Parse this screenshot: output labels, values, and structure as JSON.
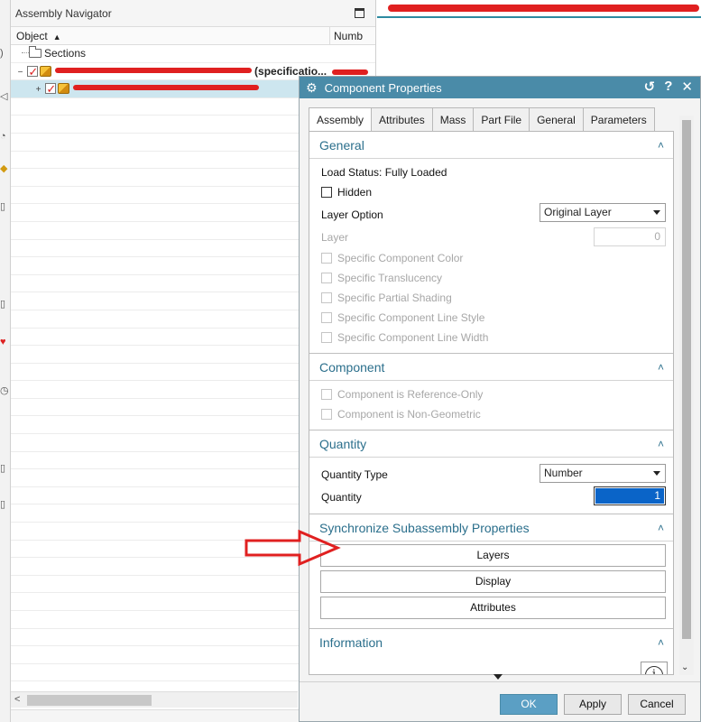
{
  "navigator": {
    "title": "Assembly Navigator",
    "columns": {
      "object": "Object",
      "number": "Numb"
    },
    "rows": [
      {
        "label": "Sections"
      },
      {
        "label": "(specificatio..."
      },
      {
        "label": ""
      }
    ],
    "empty_row_count": 33
  },
  "dialog": {
    "title": "Component Properties",
    "title_buttons": {
      "reset": "↺",
      "help": "?",
      "close": "✕"
    },
    "tabs": [
      "Assembly",
      "Attributes",
      "Mass",
      "Part File",
      "General",
      "Parameters"
    ],
    "active_tab": "Assembly",
    "general": {
      "heading": "General",
      "load_status": "Load Status: Fully Loaded",
      "hidden_label": "Hidden",
      "layer_option_label": "Layer Option",
      "layer_option_value": "Original Layer",
      "layer_label": "Layer",
      "layer_value": "0",
      "specific_color": "Specific Component Color",
      "specific_translucency": "Specific Translucency",
      "specific_partial_shading": "Specific Partial Shading",
      "specific_line_style": "Specific Component Line Style",
      "specific_line_width": "Specific Component Line Width"
    },
    "component": {
      "heading": "Component",
      "reference_only": "Component is Reference-Only",
      "non_geometric": "Component is Non-Geometric"
    },
    "quantity": {
      "heading": "Quantity",
      "type_label": "Quantity Type",
      "type_value": "Number",
      "quantity_label": "Quantity",
      "quantity_value": "1"
    },
    "sync": {
      "heading": "Synchronize Subassembly Properties",
      "layers": "Layers",
      "display": "Display",
      "attributes": "Attributes"
    },
    "information": {
      "heading": "Information"
    },
    "footer": {
      "ok": "OK",
      "apply": "Apply",
      "cancel": "Cancel"
    }
  },
  "colors": {
    "title_bar": "#4a8ba8",
    "section_heading": "#2b6f8c",
    "annotation": "#e02020"
  },
  "icons": {
    "gear": "gear-icon",
    "collapse": "chevron-up-icon",
    "info": "info-icon",
    "dropdown": "caret-down-icon"
  }
}
